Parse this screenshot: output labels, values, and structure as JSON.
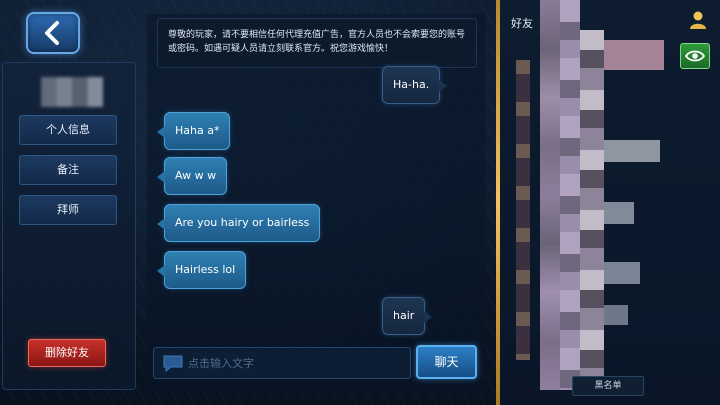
{
  "notice": {
    "text": "尊敬的玩家，请不要相信任何代理充值广告，官方人员也不会索要您的账号或密码。如遇可疑人员请立刻联系官方。祝您游戏愉快！"
  },
  "left_menu": {
    "items": [
      {
        "label": "个人信息"
      },
      {
        "label": "备注"
      },
      {
        "label": "拜师"
      }
    ],
    "delete_label": "删除好友"
  },
  "messages": [
    {
      "side": "out",
      "text": "Ha-ha."
    },
    {
      "side": "in",
      "text": "Haha a*"
    },
    {
      "side": "in",
      "text": "Aw w w"
    },
    {
      "side": "in",
      "text": "Are you hairy or bairless"
    },
    {
      "side": "in",
      "text": "Hairless lol"
    },
    {
      "side": "out",
      "text": "hair"
    }
  ],
  "input": {
    "placeholder": "点击输入文字",
    "value": ""
  },
  "send_label": "聊天",
  "friends": {
    "title": "好友",
    "blacklist_label": "黑名单"
  },
  "colors": {
    "accent_blue": "#2f80b4",
    "delete_red": "#c8302a",
    "divider_gold": "#f1c360",
    "eye_green": "#2f9a3c"
  }
}
